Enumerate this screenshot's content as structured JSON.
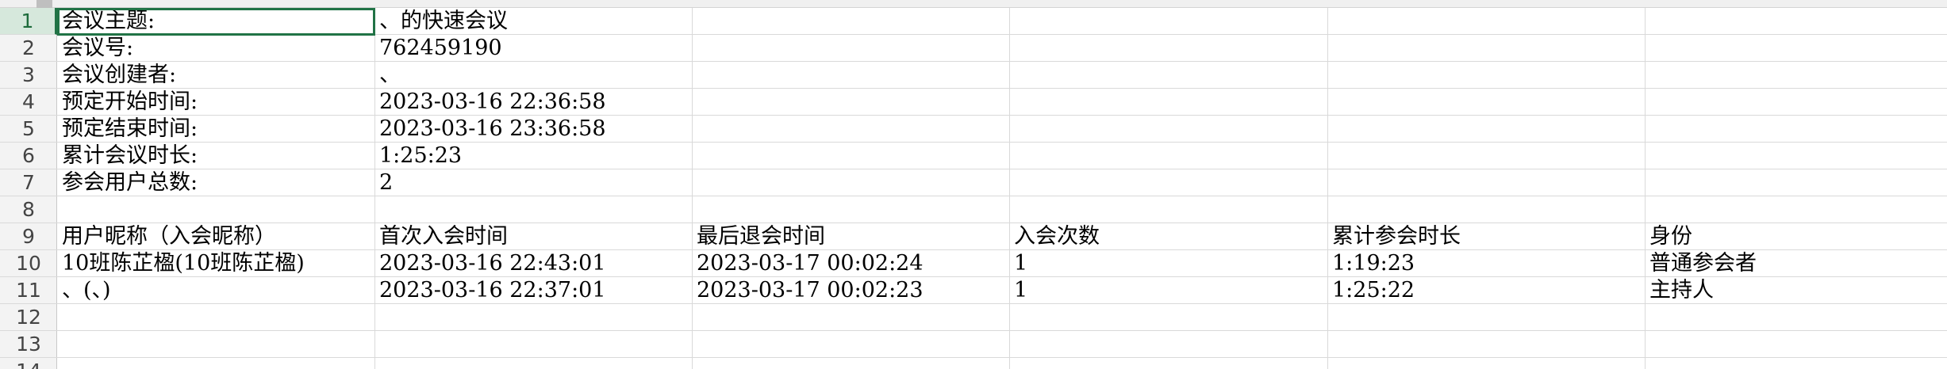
{
  "row_numbers": [
    "1",
    "2",
    "3",
    "4",
    "5",
    "6",
    "7",
    "8",
    "9",
    "10",
    "11",
    "12",
    "13",
    "14"
  ],
  "rows": {
    "r1": {
      "a": "会议主题:",
      "b": "、的快速会议"
    },
    "r2": {
      "a": "会议号:",
      "b": "762459190"
    },
    "r3": {
      "a": "会议创建者:",
      "b": "、"
    },
    "r4": {
      "a": "预定开始时间:",
      "b": "2023-03-16 22:36:58"
    },
    "r5": {
      "a": "预定结束时间:",
      "b": "2023-03-16 23:36:58"
    },
    "r6": {
      "a": "累计会议时长:",
      "b": "1:25:23"
    },
    "r7": {
      "a": "参会用户总数:",
      "b": "2"
    },
    "r9": {
      "a": "用户昵称（入会昵称）",
      "b": "首次入会时间",
      "c": "最后退会时间",
      "d": "入会次数",
      "e": "累计参会时长",
      "f": "身份"
    },
    "r10": {
      "a": "10班陈芷楹(10班陈芷楹)",
      "b": "2023-03-16 22:43:01",
      "c": "2023-03-17 00:02:24",
      "d": "1",
      "e": "1:19:23",
      "f": "普通参会者"
    },
    "r11": {
      "a": "、(、)",
      "b": "2023-03-16 22:37:01",
      "c": "2023-03-17 00:02:23",
      "d": "1",
      "e": "1:25:22",
      "f": "主持人"
    }
  },
  "selected_cell": "A1",
  "accent_color": "#217346"
}
